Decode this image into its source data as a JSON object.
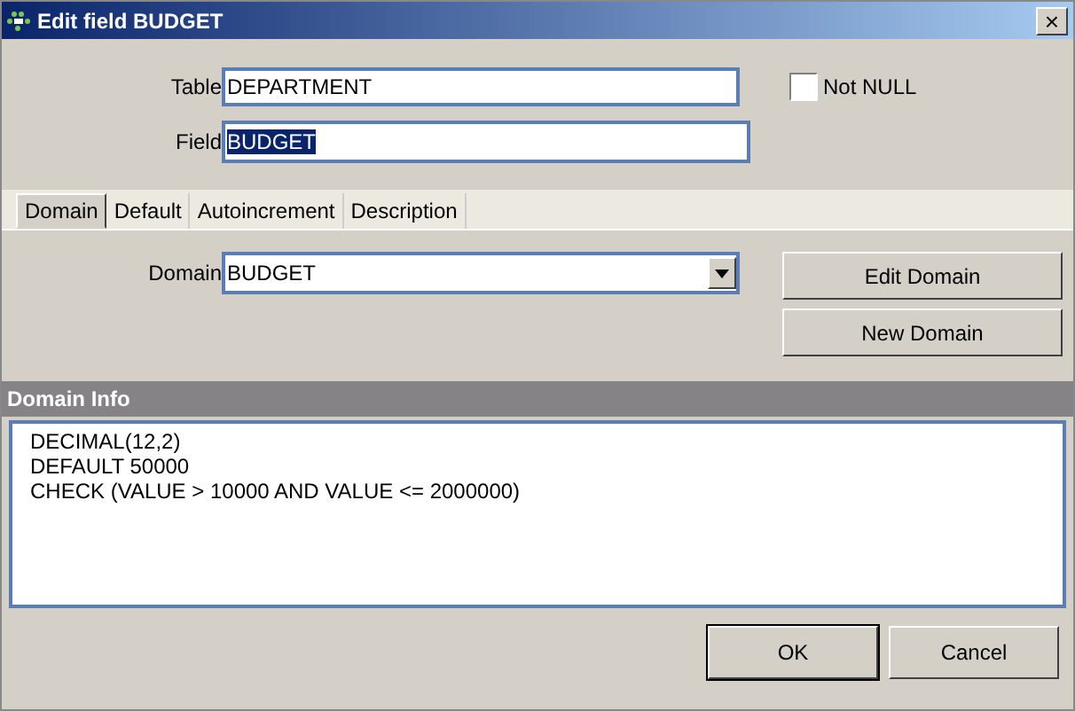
{
  "window": {
    "title": "Edit field BUDGET",
    "close": "×"
  },
  "table": {
    "label": "Table",
    "value": "DEPARTMENT"
  },
  "field": {
    "label": "Field",
    "value": "BUDGET",
    "text_selected": true
  },
  "not_null": {
    "label": "Not NULL",
    "checked": false
  },
  "tabs": [
    {
      "label": "Domain",
      "selected": true
    },
    {
      "label": "Default",
      "selected": false
    },
    {
      "label": "Autoincrement",
      "selected": false
    },
    {
      "label": "Description",
      "selected": false
    }
  ],
  "domain": {
    "label": "Domain",
    "value": "BUDGET"
  },
  "domain_buttons": [
    "Edit Domain",
    "New Domain"
  ],
  "domain_info": {
    "title": "Domain Info",
    "lines": [
      "DECIMAL(12,2)",
      "DEFAULT 50000",
      "CHECK (VALUE > 10000 AND VALUE <= 2000000)"
    ]
  },
  "buttons": [
    {
      "label": "OK",
      "default": true
    },
    {
      "label": "Cancel",
      "default": false
    }
  ]
}
